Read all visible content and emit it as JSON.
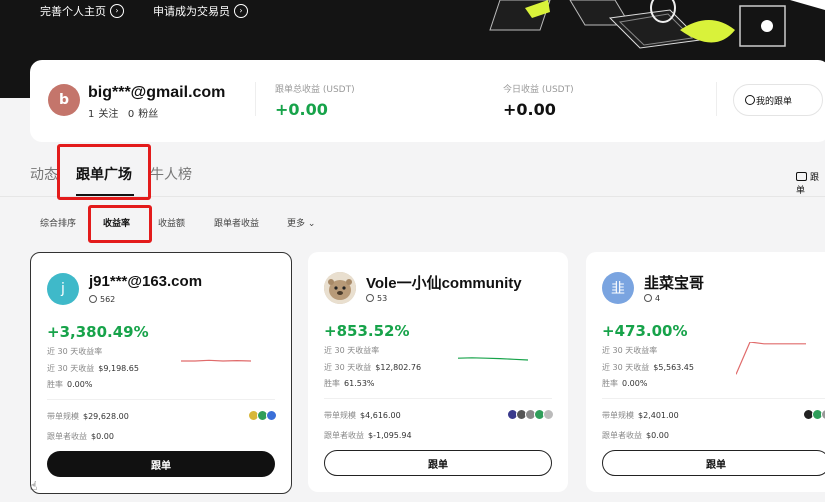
{
  "banner": {
    "links": [
      "完善个人主页",
      "申请成为交易员"
    ]
  },
  "profile": {
    "avatar_letter": "b",
    "name": "big***@gmail.com",
    "following_count": "1",
    "following_label": "关注",
    "followers_count": "0",
    "followers_label": "粉丝",
    "total_label": "跟单总收益 (USDT)",
    "total_value": "+0.00",
    "today_label": "今日收益 (USDT)",
    "today_value": "+0.00",
    "my_copy_label": "我的跟单"
  },
  "tabs": [
    "动态",
    "跟单广场",
    "牛人榜"
  ],
  "right_tab": "跟单",
  "filters": [
    "综合排序",
    "收益率",
    "收益额",
    "跟单者收益",
    "更多"
  ],
  "card_labels": {
    "ret_label": "近 30 天收益率",
    "pnl_label": "近 30 天收益",
    "win_label": "胜率",
    "aum_label": "带单规模",
    "follower_pnl_label": "跟单者收益",
    "copy_button": "跟单"
  },
  "traders": [
    {
      "avatar": "j",
      "avatar_color": "#3fb9c9",
      "name": "j91***@163.com",
      "followers": "562",
      "return_pct": "+3,380.49%",
      "pnl_30d": "$9,198.65",
      "win_rate": "0.00%",
      "aum": "$29,628.00",
      "follower_pnl": "$0.00",
      "spark": [
        0.5,
        0.5,
        0.52,
        0.5,
        0.51,
        0.5
      ],
      "spark_color": "#e06b6b",
      "coin_colors": [
        "#d8b73a",
        "#2f9e5a",
        "#3a6fd8"
      ]
    },
    {
      "avatar": "otter",
      "avatar_color": "#c9b9a0",
      "name": "Vole一小仙community",
      "followers": "53",
      "return_pct": "+853.52%",
      "pnl_30d": "$12,802.76",
      "win_rate": "61.53%",
      "aum": "$4,616.00",
      "follower_pnl": "$-1,095.94",
      "spark": [
        0.55,
        0.56,
        0.55,
        0.54,
        0.52,
        0.5
      ],
      "spark_color": "#17a34a",
      "coin_colors": [
        "#3a3a8c",
        "#555",
        "#888",
        "#2f9e5a",
        "#bbb"
      ]
    },
    {
      "avatar": "韭",
      "avatar_color": "#7aa4e0",
      "name": "韭菜宝哥",
      "followers": "4",
      "return_pct": "+473.00%",
      "pnl_30d": "$5,563.45",
      "win_rate": "0.00%",
      "aum": "$2,401.00",
      "follower_pnl": "$0.00",
      "spark": [
        0.1,
        1.0,
        0.95,
        0.95,
        0.95,
        0.95
      ],
      "spark_color": "#e06b6b",
      "coin_colors": [
        "#222",
        "#2f9e5a",
        "#999"
      ]
    }
  ]
}
